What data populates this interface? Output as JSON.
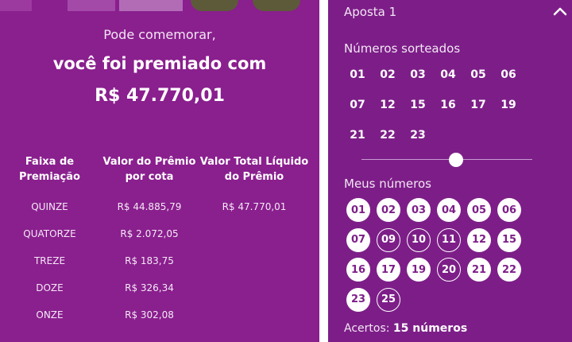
{
  "result": {
    "congrats_text": "Pode comemorar,",
    "prize_line": "você foi premiado com",
    "prize_value": "R$ 47.770,01"
  },
  "table": {
    "headers": [
      {
        "line1": "Faixa de",
        "line2": "Premiação"
      },
      {
        "line1": "Valor do Prêmio",
        "line2": "por cota"
      },
      {
        "line1": "Valor Total Líquido",
        "line2": "do Prêmio"
      }
    ],
    "rows": [
      {
        "tier": "QUINZE",
        "per_share": "R$ 44.885,79",
        "total": "R$ 47.770,01"
      },
      {
        "tier": "QUATORZE",
        "per_share": "R$ 2.072,05",
        "total": ""
      },
      {
        "tier": "TREZE",
        "per_share": "R$ 183,75",
        "total": ""
      },
      {
        "tier": "DOZE",
        "per_share": "R$ 326,34",
        "total": ""
      },
      {
        "tier": "ONZE",
        "per_share": "R$ 302,08",
        "total": ""
      }
    ]
  },
  "bet": {
    "title": "Aposta 1",
    "collapse_icon": "chevron-up-icon",
    "drawn_label": "Números sorteados",
    "drawn_numbers": [
      "01",
      "02",
      "03",
      "04",
      "05",
      "06",
      "07",
      "12",
      "15",
      "16",
      "17",
      "19",
      "21",
      "22",
      "23"
    ],
    "my_numbers_label": "Meus números",
    "my_numbers": [
      {
        "n": "01",
        "hit": true
      },
      {
        "n": "02",
        "hit": true
      },
      {
        "n": "03",
        "hit": true
      },
      {
        "n": "04",
        "hit": true
      },
      {
        "n": "05",
        "hit": true
      },
      {
        "n": "06",
        "hit": true
      },
      {
        "n": "07",
        "hit": true
      },
      {
        "n": "09",
        "hit": false
      },
      {
        "n": "10",
        "hit": false
      },
      {
        "n": "11",
        "hit": false
      },
      {
        "n": "12",
        "hit": true
      },
      {
        "n": "15",
        "hit": true
      },
      {
        "n": "16",
        "hit": true
      },
      {
        "n": "17",
        "hit": true
      },
      {
        "n": "19",
        "hit": true
      },
      {
        "n": "20",
        "hit": false
      },
      {
        "n": "21",
        "hit": true
      },
      {
        "n": "22",
        "hit": true
      },
      {
        "n": "23",
        "hit": true
      },
      {
        "n": "25",
        "hit": false
      }
    ],
    "hits_label": "Acertos:",
    "hits_value": "15 números"
  },
  "colors": {
    "panel_left": "#8a1f8e",
    "panel_right": "#7d1e88",
    "ball_hit_bg": "#ffffff",
    "ball_hit_text": "#7d1e88"
  }
}
